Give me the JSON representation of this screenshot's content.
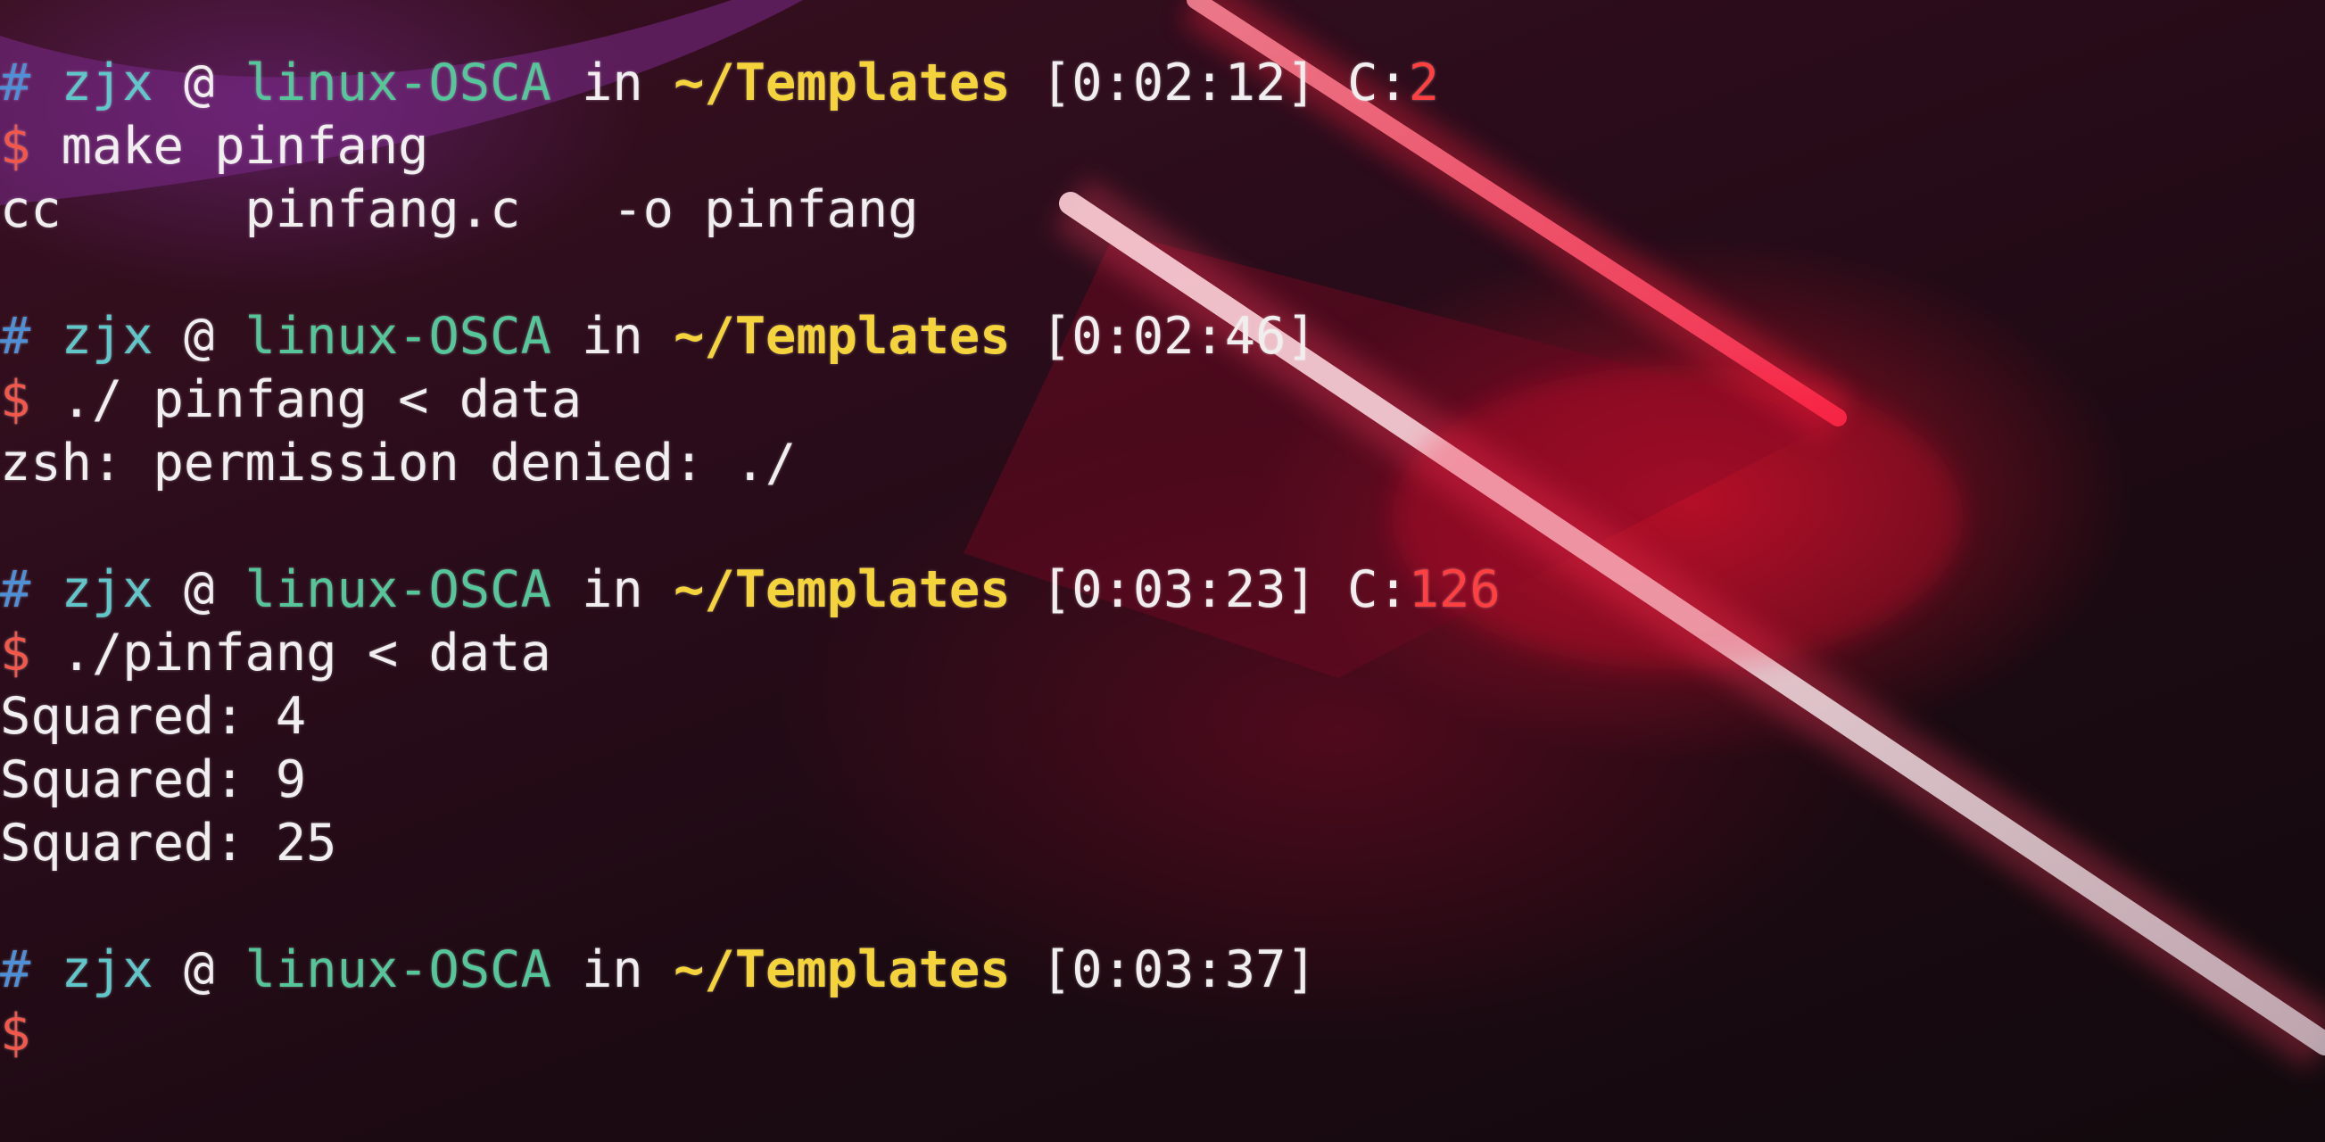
{
  "prompt": {
    "hash": "#",
    "user": "zjx",
    "at": "@",
    "host": "linux-OSCA",
    "in": "in",
    "path": "~/Templates",
    "dollar": "$",
    "code_label": "C:"
  },
  "blocks": [
    {
      "time": "[0:02:12]",
      "exit_code": "2",
      "command": "make pinfang",
      "output": [
        "cc      pinfang.c   -o pinfang"
      ]
    },
    {
      "time": "[0:02:46]",
      "exit_code": "",
      "command": "./ pinfang < data",
      "output": [
        "zsh: permission denied: ./"
      ]
    },
    {
      "time": "[0:03:23]",
      "exit_code": "126",
      "command": "./pinfang < data",
      "output": [
        "Squared: 4",
        "Squared: 9",
        "Squared: 25"
      ]
    },
    {
      "time": "[0:03:37]",
      "exit_code": "",
      "command": "",
      "output": []
    }
  ],
  "colors": {
    "hash": "#4f8fd6",
    "user": "#5fc6c9",
    "host": "#54c69a",
    "path": "#f5d33a",
    "exit_code": "#ff4040",
    "dollar": "#f2584a"
  }
}
